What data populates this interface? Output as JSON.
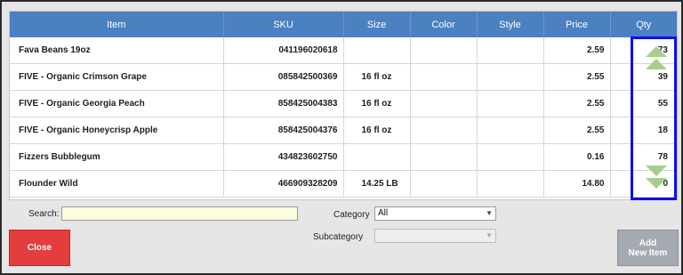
{
  "grid": {
    "columns": [
      "Item",
      "SKU",
      "Size",
      "Color",
      "Style",
      "Price",
      "Qty"
    ],
    "rows": [
      {
        "item": "Fava Beans 19oz",
        "sku": "041196020618",
        "size": "",
        "color": "",
        "style": "",
        "price": "2.59",
        "qty": "73"
      },
      {
        "item": "FIVE - Organic Crimson Grape",
        "sku": "085842500369",
        "size": "16 fl oz",
        "color": "",
        "style": "",
        "price": "2.55",
        "qty": "39"
      },
      {
        "item": "FIVE - Organic Georgia Peach",
        "sku": "858425004383",
        "size": "16 fl oz",
        "color": "",
        "style": "",
        "price": "2.55",
        "qty": "55"
      },
      {
        "item": "FIVE - Organic Honeycrisp Apple",
        "sku": "858425004376",
        "size": "16 fl oz",
        "color": "",
        "style": "",
        "price": "2.55",
        "qty": "18"
      },
      {
        "item": "Fizzers Bubblegum",
        "sku": "434823602750",
        "size": "",
        "color": "",
        "style": "",
        "price": "0.16",
        "qty": "78"
      },
      {
        "item": "Flounder Wild",
        "sku": "466909328209",
        "size": "14.25 LB",
        "color": "",
        "style": "",
        "price": "14.80",
        "qty": "0"
      }
    ]
  },
  "scroll_icons": {
    "up": "double-chevron-up-icon",
    "down": "double-chevron-down-icon",
    "color": "#a6cf8c"
  },
  "highlight_color": "#0d0df0",
  "search": {
    "label": "Search:",
    "value": ""
  },
  "category": {
    "label": "Category",
    "value": "All"
  },
  "subcategory": {
    "label": "Subcategory",
    "value": ""
  },
  "buttons": {
    "close": "Close",
    "add_line1": "Add",
    "add_line2": "New Item"
  },
  "colors": {
    "header": "#4b80c1",
    "close": "#e43d3d",
    "add": "#a4aab2"
  }
}
